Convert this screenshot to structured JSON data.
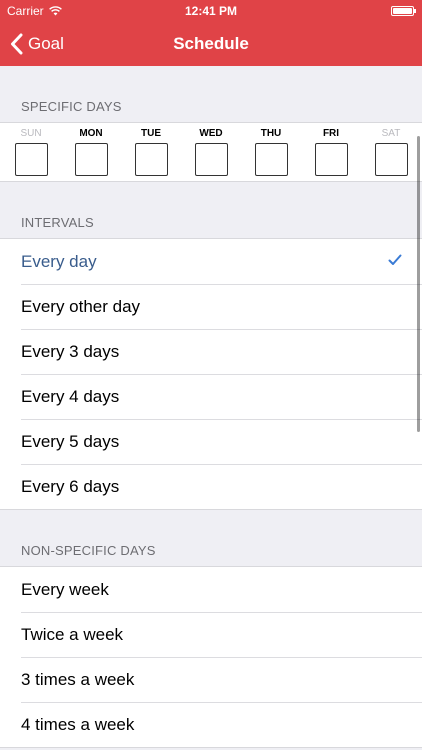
{
  "status_bar": {
    "carrier": "Carrier",
    "time": "12:41 PM"
  },
  "nav": {
    "back_label": "Goal",
    "title": "Schedule"
  },
  "specific_days": {
    "header": "SPECIFIC DAYS",
    "days": [
      {
        "label": "SUN",
        "muted": true
      },
      {
        "label": "MON",
        "muted": false
      },
      {
        "label": "TUE",
        "muted": false
      },
      {
        "label": "WED",
        "muted": false
      },
      {
        "label": "THU",
        "muted": false
      },
      {
        "label": "FRI",
        "muted": false
      },
      {
        "label": "SAT",
        "muted": true
      }
    ]
  },
  "intervals": {
    "header": "INTERVALS",
    "items": [
      "Every day",
      "Every other day",
      "Every 3 days",
      "Every 4 days",
      "Every 5 days",
      "Every 6 days"
    ],
    "selected_index": 0
  },
  "non_specific_days": {
    "header": "NON-SPECIFIC DAYS",
    "items": [
      "Every week",
      "Twice a week",
      "3 times a week",
      "4 times a week"
    ]
  },
  "colors": {
    "accent": "#e04347",
    "selected_text": "#395c8c",
    "checkmark": "#3a7bd5"
  },
  "icons": {
    "back": "chevron-left-icon",
    "selected": "checkmark-icon",
    "wifi": "wifi-icon",
    "battery": "battery-icon"
  }
}
